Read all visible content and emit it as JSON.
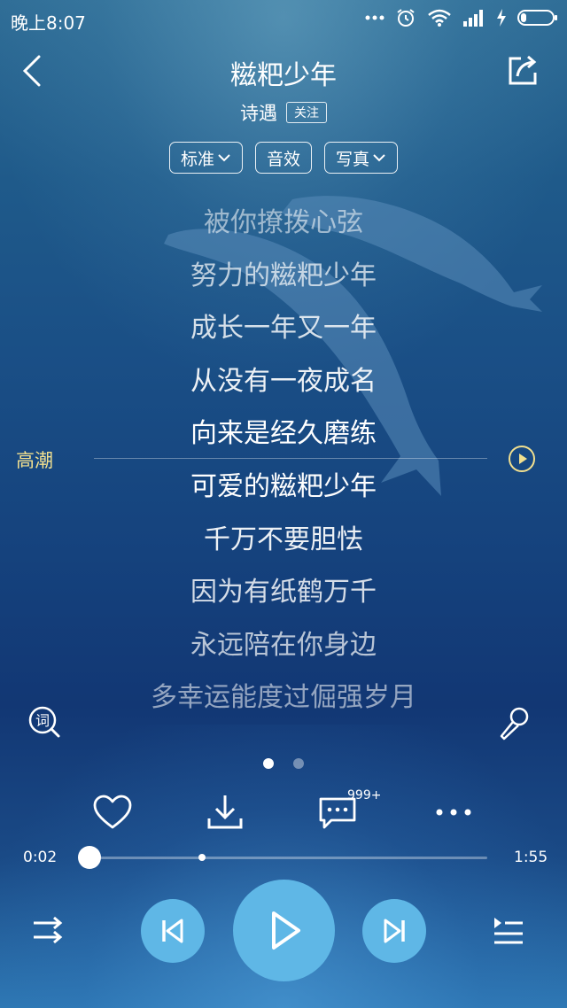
{
  "status_bar": {
    "time": "晚上8:07",
    "icons": [
      "more-dots-icon",
      "alarm-icon",
      "wifi-icon",
      "signal-icon",
      "charging-icon",
      "battery-icon"
    ]
  },
  "header": {
    "title": "糍粑少年",
    "artist": "诗遇",
    "follow_label": "关注"
  },
  "options": {
    "quality_label": "标准",
    "effects_label": "音效",
    "photo_label": "写真"
  },
  "lyrics": [
    "被你撩拨心弦",
    "努力的糍粑少年",
    "成长一年又一年",
    "从没有一夜成名",
    "向来是经久磨练",
    "可爱的糍粑少年",
    "千万不要胆怯",
    "因为有纸鹤万千",
    "永远陪在你身边",
    "多幸运能度过倔强岁月"
  ],
  "lyric_opacity": [
    0.55,
    0.7,
    0.82,
    0.92,
    1.0,
    1.0,
    0.92,
    0.82,
    0.7,
    0.55
  ],
  "climax": {
    "label": "高潮"
  },
  "page_dots": {
    "count": 2,
    "active_index": 0
  },
  "actions": {
    "comment_count": "999+"
  },
  "progress": {
    "current_time": "0:02",
    "total_time": "1:55",
    "played_fraction": 0.0
  },
  "colors": {
    "accent": "#5fb7e6",
    "climax": "#f2e08f"
  }
}
